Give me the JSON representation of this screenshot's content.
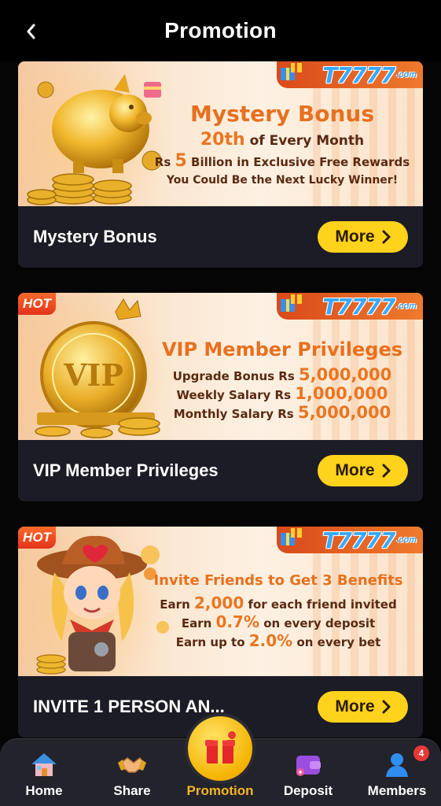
{
  "header": {
    "title": "Promotion",
    "back_icon": "chevron-left-icon"
  },
  "brand": {
    "logo_main": "T7777",
    "logo_suffix": ".com"
  },
  "cards": [
    {
      "banner": {
        "hot": "",
        "title": "Mystery Bonus",
        "line1_big": "20th",
        "line1_rest": " of Every Month",
        "line2_pre": "Rs ",
        "line2_big": "5",
        "line2_rest": " Billion in Exclusive Free Rewards",
        "line3": "You Could Be the Next Lucky Winner!"
      },
      "title": "Mystery Bonus",
      "button": "More"
    },
    {
      "banner": {
        "hot": "HOT",
        "title": "VIP Member Privileges",
        "emblem": "VIP",
        "rows": [
          {
            "label": "Upgrade Bonus Rs ",
            "value": "5,000,000"
          },
          {
            "label": "Weekly Salary Rs ",
            "value": "1,000,000"
          },
          {
            "label": "Monthly Salary Rs ",
            "value": "5,000,000"
          }
        ]
      },
      "title": "VIP Member Privileges",
      "button": "More"
    },
    {
      "banner": {
        "hot": "HOT",
        "title": "Invite Friends to Get 3 Benefits",
        "rows": [
          {
            "pre": "Earn ",
            "value": "2,000",
            "post": " for each friend invited"
          },
          {
            "pre": "Earn ",
            "value": "0.7%",
            "post": " on every deposit"
          },
          {
            "pre": "Earn up to ",
            "value": "2.0%",
            "post": " on every bet"
          }
        ]
      },
      "title": "INVITE 1 PERSON AN...",
      "button": "More"
    }
  ],
  "nav": {
    "items": [
      {
        "label": "Home",
        "icon": "house-icon"
      },
      {
        "label": "Share",
        "icon": "handshake-icon"
      },
      {
        "label": "Promotion",
        "icon": "gift-icon",
        "active": true
      },
      {
        "label": "Deposit",
        "icon": "wallet-icon"
      },
      {
        "label": "Members",
        "icon": "person-icon",
        "badge": "4"
      }
    ]
  },
  "colors": {
    "accent": "#ffd21c",
    "active_nav": "#f7b624",
    "card_bg": "#1c1c26"
  }
}
